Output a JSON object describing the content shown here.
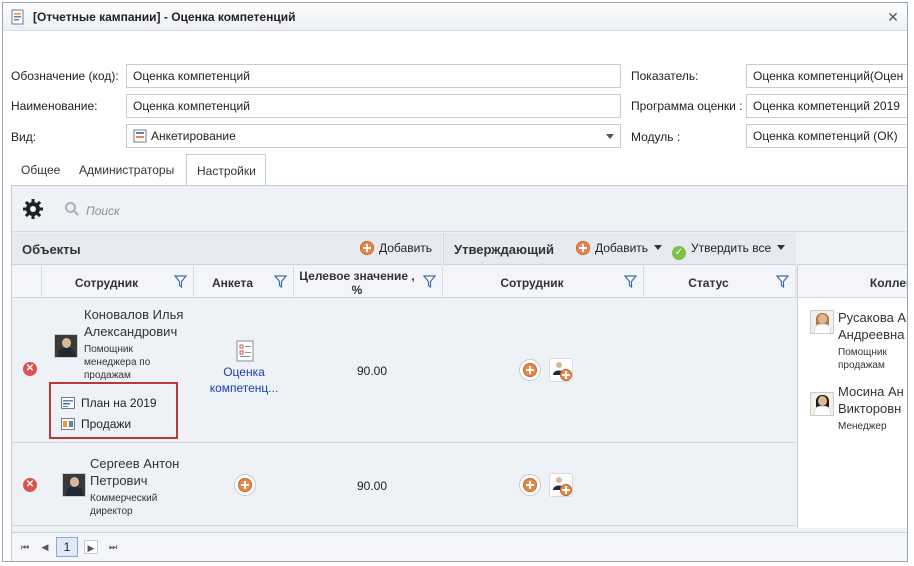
{
  "window": {
    "title": "[Отчетные кампании] - Оценка компетенций"
  },
  "form": {
    "code": {
      "label": "Обозначение (код):",
      "value": "Оценка компетенций"
    },
    "name": {
      "label": "Наименование:",
      "value": "Оценка компетенций"
    },
    "kind": {
      "label": "Вид:",
      "value": "Анкетирование"
    },
    "indicator": {
      "label": "Показатель:",
      "value": "Оценка компетенций(Оцен"
    },
    "program": {
      "label": "Программа оценки :",
      "value": "Оценка компетенций 2019"
    },
    "module": {
      "label": "Модуль :",
      "value": "Оценка компетенций (ОК)"
    }
  },
  "tabs": [
    "Общее",
    "Администраторы",
    "Настройки"
  ],
  "active_tab": "Настройки",
  "toolbar": {
    "search_placeholder": "Поиск"
  },
  "objects": {
    "title": "Объекты",
    "add_label": "Добавить",
    "columns": {
      "employee": "Сотрудник",
      "form": "Анкета",
      "target_line1": "Целевое значение ,",
      "target_line2": "%"
    }
  },
  "approvers": {
    "title": "Утверждающий",
    "add_label": "Добавить",
    "approve_all_label": "Утвердить все",
    "columns": {
      "employee": "Сотрудник",
      "status": "Статус"
    }
  },
  "colleagues": {
    "title": "Коллег"
  },
  "rows": [
    {
      "name_line1": "Коновалов Илья",
      "name_line2": "Александрович",
      "position_line1": "Помощник",
      "position_line2": "менеджера по",
      "position_line3": "продажам",
      "form_line1": "Оценка",
      "form_line2": "компетенц...",
      "target": "90.00",
      "plan": "План на 2019",
      "dept": "Продажи"
    },
    {
      "name_line1": "Сергеев Антон",
      "name_line2": "Петрович",
      "position_line1": "Коммерческий",
      "position_line2": "директор",
      "target": "90.00"
    }
  ],
  "colleague_items": [
    {
      "name_line1": "Русакова А",
      "name_line2": "Андреевна",
      "position_line1": "Помощник",
      "position_line2": "продажам"
    },
    {
      "name_line1": "Мосина Ан",
      "name_line2": "Викторовн",
      "position_line1": "Менеджер"
    }
  ],
  "pager": {
    "current_page": "1"
  },
  "colors": {
    "accent_orange": "#e8884a",
    "link_blue": "#1a3fb5",
    "highlight_red": "#b53a3a",
    "delete_red": "#d9534f",
    "approve_green": "#7cc04b"
  }
}
